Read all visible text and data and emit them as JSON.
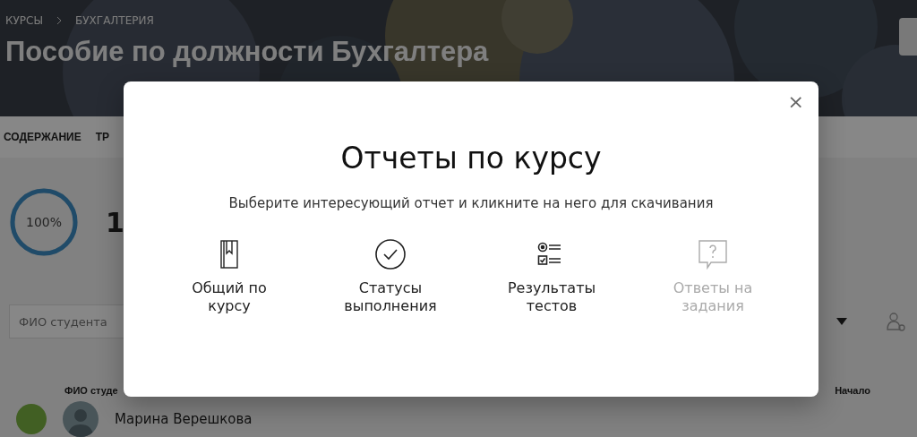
{
  "header": {
    "breadcrumbs": [
      "КУРСЫ",
      "БУХГАЛТЕРИЯ"
    ],
    "title": "Пособие по должности Бухгалтера"
  },
  "tabs": [
    "СОДЕРЖАНИЕ",
    "ТР"
  ],
  "progress": {
    "level": 1,
    "label": "100%"
  },
  "stats": {
    "value": "1"
  },
  "filters": {
    "search_placeholder": "ФИО студента"
  },
  "table": {
    "columns": [
      "ФИО студе",
      "Начало"
    ],
    "rows": [
      {
        "name": "Марина Верешкова"
      }
    ]
  },
  "modal": {
    "title": "Отчеты по курсу",
    "subtitle": "Выберите интересующий отчет и кликните на него для скачивания",
    "close": "×",
    "reports": [
      {
        "kind": "book",
        "label": "Общий по курсу",
        "disabled": false
      },
      {
        "kind": "check",
        "label": "Статусы выполнения",
        "disabled": false
      },
      {
        "kind": "list",
        "label": "Результаты тестов",
        "disabled": false
      },
      {
        "kind": "question",
        "label": "Ответы на задания",
        "disabled": true
      }
    ]
  }
}
